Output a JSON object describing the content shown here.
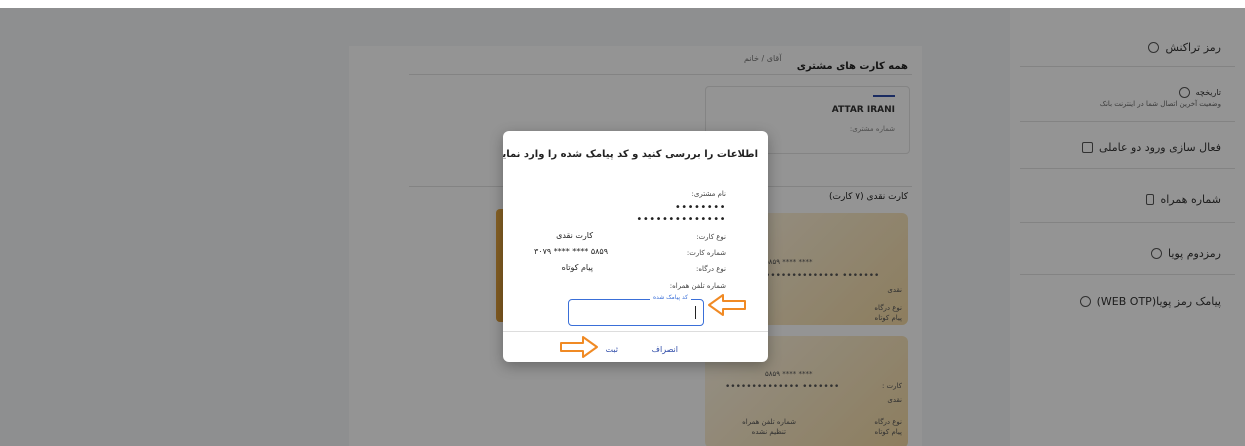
{
  "sidebar": {
    "items": [
      {
        "label": "رمز تراکنش"
      },
      {
        "label": "تاریخچه",
        "subtitle": "وضعیت آخرین اتصال شما در اینترنت بانک"
      },
      {
        "label": "فعال سازی ورود دو عاملی"
      },
      {
        "label": "شماره همراه"
      },
      {
        "label": "رمزدوم پویا"
      },
      {
        "label": "پیامک رمز پویا(WEB OTP)"
      }
    ]
  },
  "background": {
    "tab_label": "آقای / خانم",
    "all_cards_heading": "همه کارت های مشتری",
    "customer_name": "ATTAR IRANI",
    "customer_number_label": "شماره مشتری:",
    "cash_cards_heading": "کارت نقدی (۷ کارت)",
    "card1": {
      "number": "۵۸۵۹ **** ****",
      "stars": "•••••••••••••• •••••••",
      "type": "نقدی",
      "gateway_label": "نوع درگاه",
      "gateway_value": "پیام کوتاه"
    },
    "card2": {
      "number": "۵۸۵۹ **** ****",
      "prefix": "کارت :",
      "stars": "•••••••••••••• •••••••",
      "type": "نقدی",
      "gateway_label": "نوع درگاه",
      "gateway_value": "پیام کوتاه",
      "phone_label": "شماره تلفن همراه",
      "phone_value": "تنظیم نشده"
    }
  },
  "modal": {
    "title": "اطلاعات را بررسی کنید و کد پیامک شده را وارد نمایید",
    "customer_name_label": "نام مشتری:",
    "customer_name_line1": "••••••••",
    "customer_name_line2": "••••••••••••••",
    "card_type_label": "نوع کارت:",
    "card_type_value": "کارت نقدی",
    "card_number_label": "شماره کارت:",
    "card_number_value": "۵۸۵۹ **** **** ۳۰۷۹",
    "gateway_label": "نوع درگاه:",
    "gateway_value": "پیام کوتاه",
    "phone_label": "شماره تلفن همراه:",
    "otp_legend": "کد پیامک شده",
    "otp_value": "",
    "cancel_label": "انصراف",
    "submit_label": "ثبت"
  },
  "colors": {
    "accent": "#2d4aa8",
    "arrow": "#f08a24",
    "overlay": "rgba(0,0,0,0.42)",
    "card_gold": "#e6a741"
  }
}
